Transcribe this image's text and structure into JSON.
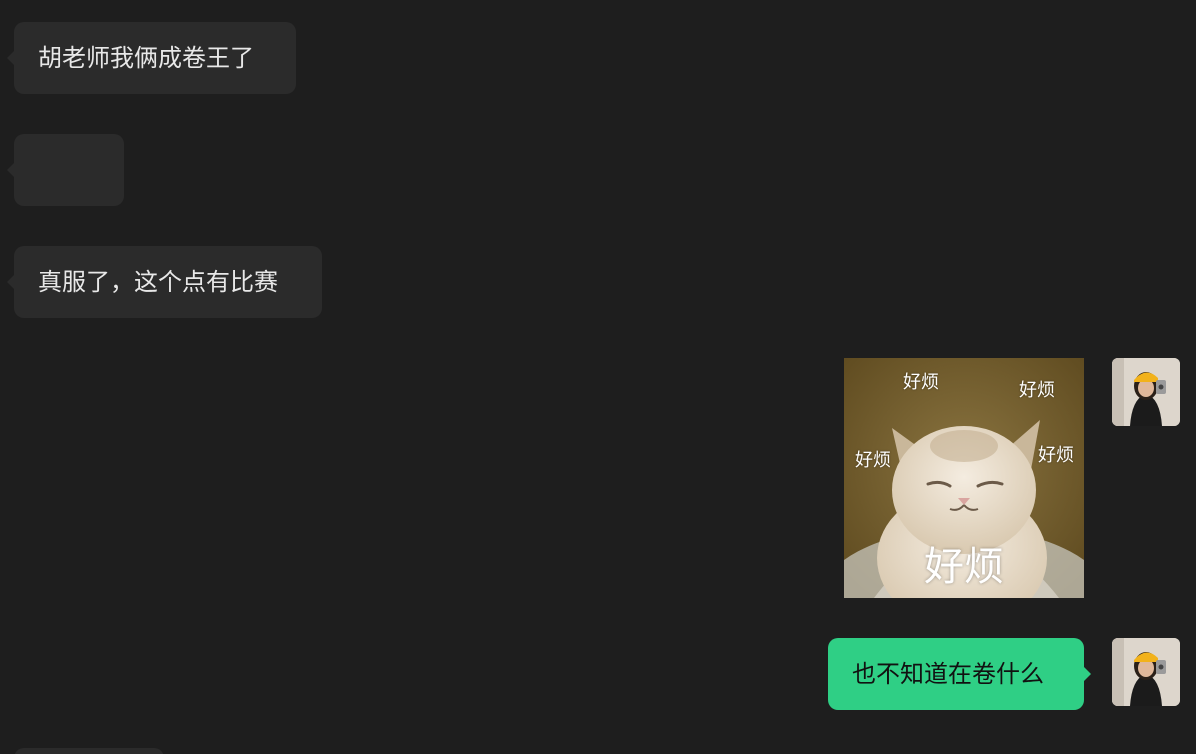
{
  "messages": {
    "m1": "胡老师我俩成卷王了",
    "m2": "",
    "m3": "真服了，这个点有比赛",
    "m5": "也不知道在卷什么"
  },
  "sticker": {
    "words": [
      "好烦",
      "好烦",
      "好烦",
      "好烦"
    ],
    "caption": "好烦"
  },
  "colors": {
    "background": "#1e1e1e",
    "incoming_bubble": "#2b2b2b",
    "outgoing_bubble": "#2fcf85"
  }
}
